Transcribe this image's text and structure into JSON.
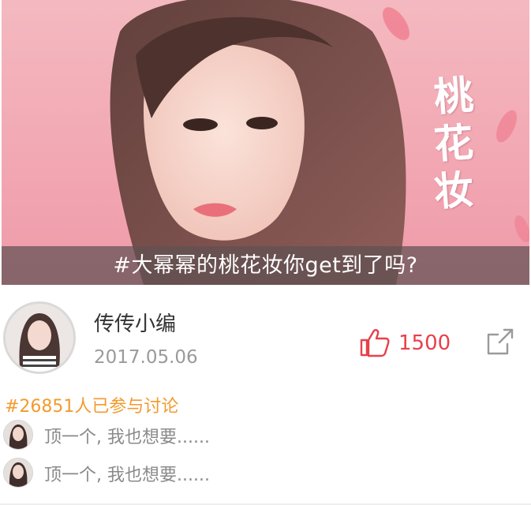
{
  "banner": {
    "calligraphy": [
      "桃",
      "花",
      "妆"
    ],
    "caption": "#大幂幂的桃花妆你get到了吗?"
  },
  "post": {
    "author": "传传小编",
    "date": "2017.05.06",
    "likes": "1500"
  },
  "discussion": {
    "participants": "#26851人已参与讨论",
    "comments": [
      {
        "text": "顶一个, 我也想要......"
      },
      {
        "text": "顶一个, 我也想要......"
      }
    ]
  },
  "colors": {
    "accent_red": "#e8404a",
    "topic_orange": "#f39a2e",
    "banner_pink": "#f2a8b3"
  },
  "icons": {
    "like": "thumbs-up-icon",
    "share": "share-icon"
  }
}
